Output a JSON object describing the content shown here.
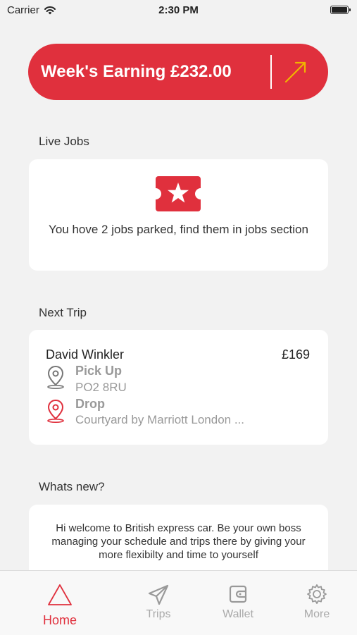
{
  "status_bar": {
    "carrier": "Carrier",
    "time": "2:30 PM"
  },
  "earning": {
    "label": "Week's Earning £232.00",
    "accent": "#e0303d",
    "arrow_color": "#f0b400"
  },
  "live_jobs": {
    "title": "Live Jobs",
    "message": "You hove 2 jobs parked, find them in jobs section",
    "icon": "ticket-star-icon"
  },
  "next_trip": {
    "title": "Next Trip",
    "passenger": "David Winkler",
    "price": "£169",
    "pickup_label": "Pick Up",
    "pickup_value": "PO2 8RU",
    "drop_label": "Drop",
    "drop_value": "Courtyard by Marriott London ..."
  },
  "whats_new": {
    "title": "Whats new?",
    "message": "Hi welcome to British express car. Be your own boss managing your schedule and trips there by giving your more flexibilty and time to yourself"
  },
  "tabs": [
    {
      "label": "Home",
      "icon": "home-triangle-icon",
      "active": true
    },
    {
      "label": "Trips",
      "icon": "paper-plane-icon",
      "active": false
    },
    {
      "label": "Wallet",
      "icon": "wallet-icon",
      "active": false
    },
    {
      "label": "More",
      "icon": "gear-icon",
      "active": false
    }
  ]
}
